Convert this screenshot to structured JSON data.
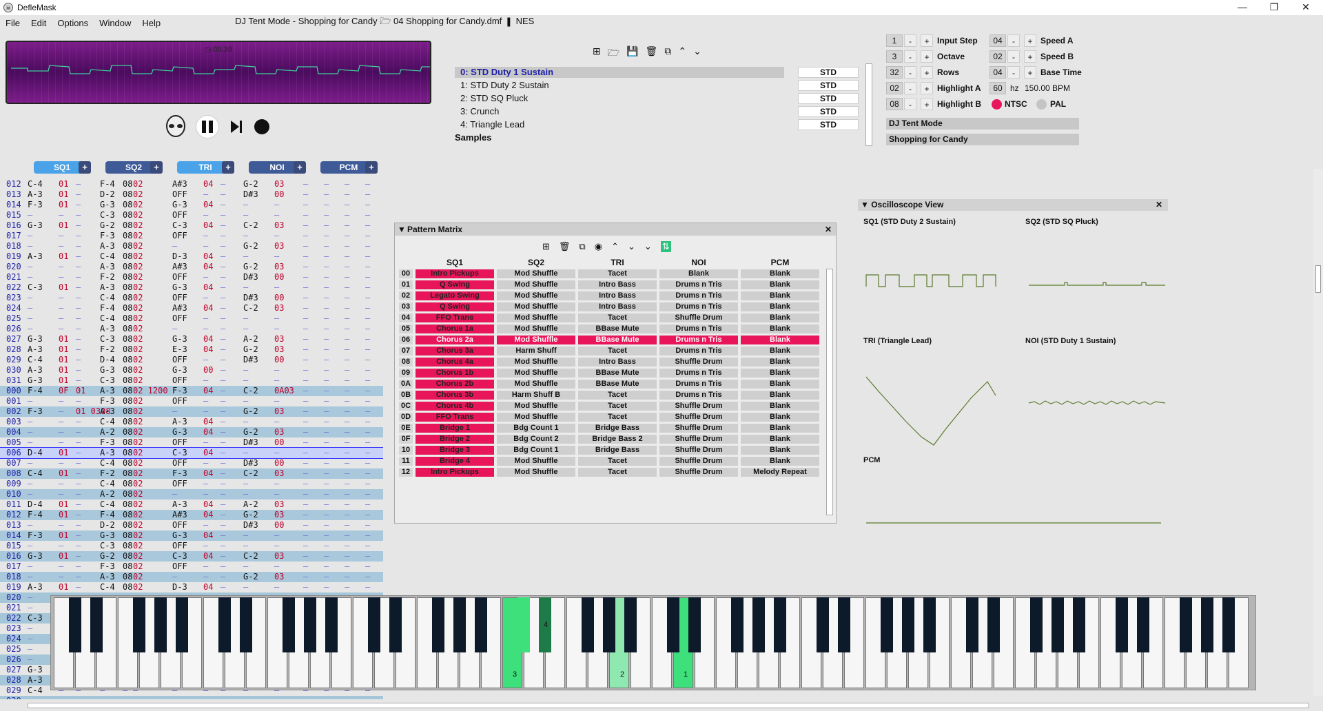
{
  "window": {
    "title": "DefleMask",
    "min": "—",
    "max": "❐",
    "close": "✕"
  },
  "menu": {
    "items": [
      "File",
      "Edit",
      "Options",
      "Window",
      "Help"
    ],
    "doc_title": "DJ Tent Mode - Shopping for Candy",
    "file": "04 Shopping for Candy.dmf",
    "system": "NES"
  },
  "player": {
    "time": "00:39"
  },
  "instruments": {
    "items": [
      {
        "label": "0: STD Duty 1 Sustain",
        "type": "STD"
      },
      {
        "label": "1: STD Duty 2 Sustain",
        "type": "STD"
      },
      {
        "label": "2: STD SQ Pluck",
        "type": "STD"
      },
      {
        "label": "3: Crunch",
        "type": "STD"
      },
      {
        "label": "4: Triangle Lead",
        "type": "STD"
      }
    ],
    "samples_label": "Samples"
  },
  "settings": {
    "input_step": {
      "value": "1",
      "label": "Input Step"
    },
    "octave": {
      "value": "3",
      "label": "Octave"
    },
    "rows": {
      "value": "32",
      "label": "Rows"
    },
    "highlight_a": {
      "value": "02",
      "label": "Highlight A"
    },
    "highlight_b": {
      "value": "08",
      "label": "Highlight B"
    },
    "speed_a": {
      "value": "04",
      "label": "Speed A"
    },
    "speed_b": {
      "value": "02",
      "label": "Speed B"
    },
    "base_time": {
      "value": "04",
      "label": "Base Time"
    },
    "hz": {
      "value": "60",
      "unit": "hz",
      "bpm": "150.00 BPM"
    },
    "ntsc": "NTSC",
    "pal": "PAL",
    "minus": "-",
    "plus": "+",
    "author": "DJ Tent Mode",
    "song": "Shopping for Candy"
  },
  "channels": [
    {
      "name": "SQ1",
      "color": "#4aa3e8"
    },
    {
      "name": "SQ2",
      "color": "#3e5b98"
    },
    {
      "name": "TRI",
      "color": "#4aa3e8"
    },
    {
      "name": "NOI",
      "color": "#3e5b98"
    },
    {
      "name": "PCM",
      "color": "#3e5b98"
    }
  ],
  "tracker_rows": [
    {
      "n": "012",
      "c": [
        "C-4",
        "01",
        "",
        "F-4",
        "08",
        "02",
        "A#3",
        "04",
        "",
        "G-2",
        "03"
      ]
    },
    {
      "n": "013",
      "c": [
        "A-3",
        "01",
        "",
        "D-2",
        "08",
        "02",
        "OFF",
        "",
        "",
        "D#3",
        "00"
      ]
    },
    {
      "n": "014",
      "c": [
        "F-3",
        "01",
        "",
        "G-3",
        "08",
        "02",
        "G-3",
        "04",
        "",
        "",
        ""
      ]
    },
    {
      "n": "015",
      "c": [
        "",
        "",
        "",
        "C-3",
        "08",
        "02",
        "OFF",
        "",
        "",
        "",
        ""
      ]
    },
    {
      "n": "016",
      "c": [
        "G-3",
        "01",
        "",
        "G-2",
        "08",
        "02",
        "C-3",
        "04",
        "",
        "C-2",
        "03"
      ]
    },
    {
      "n": "017",
      "c": [
        "",
        "",
        "",
        "F-3",
        "08",
        "02",
        "OFF",
        "",
        "",
        "",
        ""
      ]
    },
    {
      "n": "018",
      "c": [
        "",
        "",
        "",
        "A-3",
        "08",
        "02",
        "",
        "",
        "",
        "G-2",
        "03"
      ]
    },
    {
      "n": "019",
      "c": [
        "A-3",
        "01",
        "",
        "C-4",
        "08",
        "02",
        "D-3",
        "04",
        "",
        "",
        ""
      ]
    },
    {
      "n": "020",
      "c": [
        "",
        "",
        "",
        "A-3",
        "08",
        "02",
        "A#3",
        "04",
        "",
        "G-2",
        "03"
      ]
    },
    {
      "n": "021",
      "c": [
        "",
        "",
        "",
        "F-2",
        "08",
        "02",
        "OFF",
        "",
        "",
        "D#3",
        "00"
      ]
    },
    {
      "n": "022",
      "c": [
        "C-3",
        "01",
        "",
        "A-3",
        "08",
        "02",
        "G-3",
        "04",
        "",
        "",
        ""
      ]
    },
    {
      "n": "023",
      "c": [
        "",
        "",
        "",
        "C-4",
        "08",
        "02",
        "OFF",
        "",
        "",
        "D#3",
        "00"
      ]
    },
    {
      "n": "024",
      "c": [
        "",
        "",
        "",
        "F-4",
        "08",
        "02",
        "A#3",
        "04",
        "",
        "C-2",
        "03"
      ]
    },
    {
      "n": "025",
      "c": [
        "",
        "",
        "",
        "C-4",
        "08",
        "02",
        "OFF",
        "",
        "",
        "",
        ""
      ]
    },
    {
      "n": "026",
      "c": [
        "",
        "",
        "",
        "A-3",
        "08",
        "02",
        "",
        "",
        "",
        "",
        ""
      ]
    },
    {
      "n": "027",
      "c": [
        "G-3",
        "01",
        "",
        "C-3",
        "08",
        "02",
        "G-3",
        "04",
        "",
        "A-2",
        "03"
      ]
    },
    {
      "n": "028",
      "c": [
        "A-3",
        "01",
        "",
        "F-2",
        "08",
        "02",
        "E-3",
        "04",
        "",
        "G-2",
        "03"
      ]
    },
    {
      "n": "029",
      "c": [
        "C-4",
        "01",
        "",
        "D-4",
        "08",
        "02",
        "OFF",
        "",
        "",
        "D#3",
        "00"
      ]
    },
    {
      "n": "030",
      "c": [
        "A-3",
        "01",
        "",
        "G-3",
        "08",
        "02",
        "G-3",
        "00",
        "",
        "",
        ""
      ]
    },
    {
      "n": "031",
      "c": [
        "G-3",
        "01",
        "",
        "C-3",
        "08",
        "02",
        "OFF",
        "",
        "",
        "",
        ""
      ]
    },
    {
      "n": "000",
      "c": [
        "F-4",
        "0F",
        "01",
        "A-3",
        "08",
        "02 1200",
        "F-3",
        "04",
        "",
        "C-2",
        "0A03"
      ]
    },
    {
      "n": "001",
      "c": [
        "",
        "",
        "",
        "F-3",
        "08",
        "02",
        "OFF",
        "",
        "",
        "",
        ""
      ]
    },
    {
      "n": "002",
      "c": [
        "F-3",
        "",
        "01 0308",
        "A-3",
        "08",
        "02",
        "",
        "",
        "",
        "G-2",
        "03"
      ]
    },
    {
      "n": "003",
      "c": [
        "",
        "",
        "",
        "C-4",
        "08",
        "02",
        "A-3",
        "04",
        "",
        "",
        ""
      ]
    },
    {
      "n": "004",
      "c": [
        "",
        "",
        "",
        "A-2",
        "08",
        "02",
        "G-3",
        "04",
        "",
        "G-2",
        "03"
      ]
    },
    {
      "n": "005",
      "c": [
        "",
        "",
        "",
        "F-3",
        "08",
        "02",
        "OFF",
        "",
        "",
        "D#3",
        "00"
      ]
    },
    {
      "n": "006",
      "c": [
        "D-4",
        "01",
        "",
        "A-3",
        "08",
        "02",
        "C-3",
        "04",
        "",
        "",
        ""
      ]
    },
    {
      "n": "007",
      "c": [
        "",
        "",
        "",
        "C-4",
        "08",
        "02",
        "OFF",
        "",
        "",
        "D#3",
        "00"
      ]
    },
    {
      "n": "008",
      "c": [
        "C-4",
        "01",
        "",
        "F-2",
        "08",
        "02",
        "F-3",
        "04",
        "",
        "C-2",
        "03"
      ]
    },
    {
      "n": "009",
      "c": [
        "",
        "",
        "",
        "C-4",
        "08",
        "02",
        "OFF",
        "",
        "",
        "",
        ""
      ]
    },
    {
      "n": "010",
      "c": [
        "",
        "",
        "",
        "A-2",
        "08",
        "02",
        "",
        "",
        "",
        "",
        ""
      ]
    },
    {
      "n": "011",
      "c": [
        "D-4",
        "01",
        "",
        "C-4",
        "08",
        "02",
        "A-3",
        "04",
        "",
        "A-2",
        "03"
      ]
    },
    {
      "n": "012",
      "c": [
        "F-4",
        "01",
        "",
        "F-4",
        "08",
        "02",
        "A#3",
        "04",
        "",
        "G-2",
        "03"
      ]
    },
    {
      "n": "013",
      "c": [
        "",
        "",
        "",
        "D-2",
        "08",
        "02",
        "OFF",
        "",
        "",
        "D#3",
        "00"
      ]
    },
    {
      "n": "014",
      "c": [
        "F-3",
        "01",
        "",
        "G-3",
        "08",
        "02",
        "G-3",
        "04",
        "",
        "",
        ""
      ]
    },
    {
      "n": "015",
      "c": [
        "",
        "",
        "",
        "C-3",
        "08",
        "02",
        "OFF",
        "",
        "",
        "",
        ""
      ]
    },
    {
      "n": "016",
      "c": [
        "G-3",
        "01",
        "",
        "G-2",
        "08",
        "02",
        "C-3",
        "04",
        "",
        "C-2",
        "03"
      ]
    },
    {
      "n": "017",
      "c": [
        "",
        "",
        "",
        "F-3",
        "08",
        "02",
        "OFF",
        "",
        "",
        "",
        ""
      ]
    },
    {
      "n": "018",
      "c": [
        "",
        "",
        "",
        "A-3",
        "08",
        "02",
        "",
        "",
        "",
        "G-2",
        "03"
      ]
    },
    {
      "n": "019",
      "c": [
        "A-3",
        "01",
        "",
        "C-4",
        "08",
        "02",
        "D-3",
        "04",
        "",
        "",
        ""
      ]
    },
    {
      "n": "020",
      "c": [
        "",
        "",
        "",
        "",
        "",
        "",
        "",
        "",
        "",
        "",
        ""
      ]
    },
    {
      "n": "021",
      "c": [
        "",
        "",
        "",
        "",
        "",
        "",
        "",
        "",
        "",
        "",
        ""
      ]
    },
    {
      "n": "022",
      "c": [
        "C-3",
        "",
        "",
        "",
        "",
        "",
        "",
        "",
        "",
        "",
        ""
      ]
    },
    {
      "n": "023",
      "c": [
        "",
        "",
        "",
        "",
        "",
        "",
        "",
        "",
        "",
        "",
        ""
      ]
    },
    {
      "n": "024",
      "c": [
        "",
        "",
        "",
        "",
        "",
        "",
        "",
        "",
        "",
        "",
        ""
      ]
    },
    {
      "n": "025",
      "c": [
        "",
        "",
        "",
        "",
        "",
        "",
        "",
        "",
        "",
        "",
        ""
      ]
    },
    {
      "n": "026",
      "c": [
        "",
        "",
        "",
        "",
        "",
        "",
        "",
        "",
        "",
        "",
        ""
      ]
    },
    {
      "n": "027",
      "c": [
        "G-3",
        "",
        "",
        "",
        "",
        "",
        "",
        "",
        "",
        "",
        ""
      ]
    },
    {
      "n": "028",
      "c": [
        "A-3",
        "",
        "",
        "",
        "",
        "",
        "",
        "",
        "",
        "",
        ""
      ]
    },
    {
      "n": "029",
      "c": [
        "C-4",
        "",
        "",
        "",
        "",
        "",
        "",
        "",
        "",
        "",
        ""
      ]
    },
    {
      "n": "030",
      "c": [
        "",
        "",
        "",
        "",
        "",
        "",
        "",
        "",
        "",
        "",
        ""
      ]
    }
  ],
  "pattern_matrix": {
    "title": "Pattern Matrix",
    "columns": [
      "SQ1",
      "SQ2",
      "TRI",
      "NOI",
      "PCM"
    ],
    "rows": [
      {
        "id": "00",
        "cells": [
          "Intro Pickups",
          "Mod Shuffle",
          "Tacet",
          "Blank",
          "Blank"
        ]
      },
      {
        "id": "01",
        "cells": [
          "Q Swing",
          "Mod Shuffle",
          "Intro Bass",
          "Drums n Tris",
          "Blank"
        ]
      },
      {
        "id": "02",
        "cells": [
          "Legato Swing",
          "Mod Shuffle",
          "Intro Bass",
          "Drums n Tris",
          "Blank"
        ]
      },
      {
        "id": "03",
        "cells": [
          "Q Swing",
          "Mod Shuffle",
          "Intro Bass",
          "Drums n Tris",
          "Blank"
        ]
      },
      {
        "id": "04",
        "cells": [
          "FFO Trans",
          "Mod Shuffle",
          "Tacet",
          "Shuffle Drum",
          "Blank"
        ]
      },
      {
        "id": "05",
        "cells": [
          "Chorus 1a",
          "Mod Shuffle",
          "BBase Mute",
          "Drums n Tris",
          "Blank"
        ]
      },
      {
        "id": "06",
        "cells": [
          "Chorus 2a",
          "Mod Shuffle",
          "BBase Mute",
          "Drums n Tris",
          "Blank"
        ]
      },
      {
        "id": "07",
        "cells": [
          "Chorus 3a",
          "Harm Shuff",
          "Tacet",
          "Drums n Tris",
          "Blank"
        ]
      },
      {
        "id": "08",
        "cells": [
          "Chorus 4a",
          "Mod Shuffle",
          "Intro Bass",
          "Shuffle Drum",
          "Blank"
        ]
      },
      {
        "id": "09",
        "cells": [
          "Chorus 1b",
          "Mod Shuffle",
          "BBase Mute",
          "Drums n Tris",
          "Blank"
        ]
      },
      {
        "id": "0A",
        "cells": [
          "Chorus 2b",
          "Mod Shuffle",
          "BBase Mute",
          "Drums n Tris",
          "Blank"
        ]
      },
      {
        "id": "0B",
        "cells": [
          "Chorus 3b",
          "Harm Shuff B",
          "Tacet",
          "Drums n Tris",
          "Blank"
        ]
      },
      {
        "id": "0C",
        "cells": [
          "Chorus 4b",
          "Mod Shuffle",
          "Tacet",
          "Shuffle Drum",
          "Blank"
        ]
      },
      {
        "id": "0D",
        "cells": [
          "FFO Trans",
          "Mod Shuffle",
          "Tacet",
          "Shuffle Drum",
          "Blank"
        ]
      },
      {
        "id": "0E",
        "cells": [
          "Bridge 1",
          "Bdg Count 1",
          "Bridge Bass",
          "Shuffle Drum",
          "Blank"
        ]
      },
      {
        "id": "0F",
        "cells": [
          "Bridge 2",
          "Bdg Count 2",
          "Bridge Bass 2",
          "Shuffle Drum",
          "Blank"
        ]
      },
      {
        "id": "10",
        "cells": [
          "Bridge 3",
          "Bdg Count 1",
          "Bridge Bass",
          "Shuffle Drum",
          "Blank"
        ]
      },
      {
        "id": "11",
        "cells": [
          "Bridge 4",
          "Mod Shuffle",
          "Tacet",
          "Shuffle Drum",
          "Blank"
        ]
      },
      {
        "id": "12",
        "cells": [
          "Intro Pickups",
          "Mod Shuffle",
          "Tacet",
          "Shuffle Drum",
          "Melody Repeat"
        ]
      }
    ]
  },
  "oscilloscope": {
    "title": "Oscilloscope View",
    "sq1": "SQ1 (STD Duty 2 Sustain)",
    "sq2": "SQ2 (STD SQ Pluck)",
    "tri": "TRI (Triangle Lead)",
    "noi": "NOI (STD Duty 1 Sustain)",
    "pcm": "PCM"
  },
  "piano": {
    "labels": [
      "3",
      "4",
      "2",
      "1"
    ]
  }
}
